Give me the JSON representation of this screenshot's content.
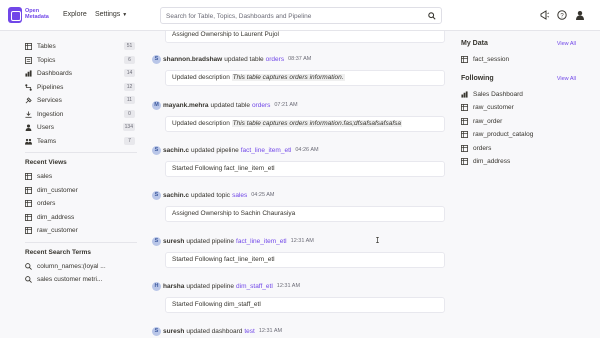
{
  "header": {
    "brand_line1": "Open",
    "brand_line2": "Metadata",
    "nav_explore": "Explore",
    "nav_settings": "Settings",
    "search_placeholder": "Search for Table, Topics, Dashboards and Pipeline"
  },
  "sidebar": {
    "items": [
      {
        "label": "Tables",
        "count": "51",
        "icon": "table-icon"
      },
      {
        "label": "Topics",
        "count": "6",
        "icon": "topic-icon"
      },
      {
        "label": "Dashboards",
        "count": "14",
        "icon": "dashboard-icon"
      },
      {
        "label": "Pipelines",
        "count": "12",
        "icon": "pipeline-icon"
      },
      {
        "label": "Services",
        "count": "11",
        "icon": "services-icon"
      },
      {
        "label": "Ingestion",
        "count": "0",
        "icon": "ingestion-icon"
      },
      {
        "label": "Users",
        "count": "134",
        "icon": "users-icon"
      },
      {
        "label": "Teams",
        "count": "7",
        "icon": "teams-icon"
      }
    ],
    "recent_views_title": "Recent Views",
    "recent_views": [
      "sales",
      "dim_customer",
      "orders",
      "dim_address",
      "raw_customer"
    ],
    "recent_search_title": "Recent Search Terms",
    "recent_searches": [
      "column_names:(loyal ...",
      "sales customer metri..."
    ]
  },
  "feed": {
    "top_message": "Assigned Ownership to Laurent Pujol",
    "entries": [
      {
        "initial": "S",
        "user": "shannon.bradshaw",
        "action": "updated table",
        "target": "orders",
        "time": "08:37 AM",
        "message": "Updated description",
        "desc": "This table captures orders information."
      },
      {
        "initial": "M",
        "user": "mayank.mehra",
        "action": "updated table",
        "target": "orders",
        "time": "07:21 AM",
        "message": "Updated description",
        "desc": "This table captures orders information.fas;dfsafsafsafsafsa"
      },
      {
        "initial": "S",
        "user": "sachin.c",
        "action": "updated pipeline",
        "target": "fact_line_item_etl",
        "time": "04:26 AM",
        "message": "Started Following fact_line_item_etl",
        "desc": ""
      },
      {
        "initial": "S",
        "user": "sachin.c",
        "action": "updated topic",
        "target": "sales",
        "time": "04:25 AM",
        "message": "Assigned Ownership to Sachin Chaurasiya",
        "desc": ""
      },
      {
        "initial": "S",
        "user": "suresh",
        "action": "updated pipeline",
        "target": "fact_line_item_etl",
        "time": "12:31 AM",
        "message": "Started Following fact_line_item_etl",
        "desc": ""
      },
      {
        "initial": "H",
        "user": "harsha",
        "action": "updated pipeline",
        "target": "dim_staff_etl",
        "time": "12:31 AM",
        "message": "Started Following dim_staff_etl",
        "desc": ""
      },
      {
        "initial": "S",
        "user": "suresh",
        "action": "updated dashboard",
        "target": "test",
        "time": "12:31 AM",
        "message": "",
        "desc": ""
      }
    ]
  },
  "right": {
    "my_data_title": "My Data",
    "my_data_view": "View All",
    "my_data": [
      "fact_session"
    ],
    "following_title": "Following",
    "following_view": "View All",
    "following": [
      {
        "label": "Sales Dashboard",
        "icon": "dashboard-icon"
      },
      {
        "label": "raw_customer",
        "icon": "table-icon"
      },
      {
        "label": "raw_order",
        "icon": "table-icon"
      },
      {
        "label": "raw_product_catalog",
        "icon": "table-icon"
      },
      {
        "label": "orders",
        "icon": "table-icon"
      },
      {
        "label": "dim_address",
        "icon": "table-icon"
      }
    ]
  },
  "colors": {
    "accent": "#7147e8",
    "avatar_bg": "#b9c6e8"
  }
}
